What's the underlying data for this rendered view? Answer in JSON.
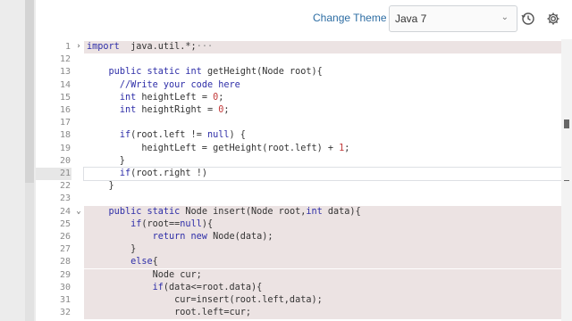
{
  "header": {
    "change_theme": "Change Theme",
    "language": "Java 7"
  },
  "editor": {
    "lines": [
      {
        "n": "1",
        "fold": "›",
        "hl": "pink",
        "tokens": [
          [
            "kw",
            "import"
          ],
          [
            "",
            "  java.util.*;"
          ],
          [
            "ellip",
            "···"
          ]
        ]
      },
      {
        "n": "12",
        "fold": "",
        "hl": "",
        "tokens": []
      },
      {
        "n": "13",
        "fold": "",
        "hl": "",
        "tokens": [
          [
            "",
            "    "
          ],
          [
            "kw",
            "public static int"
          ],
          [
            "",
            " getHeight(Node root){"
          ]
        ]
      },
      {
        "n": "14",
        "fold": "",
        "hl": "",
        "tokens": [
          [
            "",
            "      "
          ],
          [
            "cm",
            "//Write your code here"
          ]
        ]
      },
      {
        "n": "15",
        "fold": "",
        "hl": "",
        "tokens": [
          [
            "",
            "      "
          ],
          [
            "kw",
            "int"
          ],
          [
            "",
            " heightLeft = "
          ],
          [
            "num",
            "0"
          ],
          [
            "",
            ";"
          ]
        ]
      },
      {
        "n": "16",
        "fold": "",
        "hl": "",
        "tokens": [
          [
            "",
            "      "
          ],
          [
            "kw",
            "int"
          ],
          [
            "",
            " heightRight = "
          ],
          [
            "num",
            "0"
          ],
          [
            "",
            ";"
          ]
        ]
      },
      {
        "n": "17",
        "fold": "",
        "hl": "",
        "tokens": []
      },
      {
        "n": "18",
        "fold": "",
        "hl": "",
        "tokens": [
          [
            "",
            "      "
          ],
          [
            "kw",
            "if"
          ],
          [
            "",
            "(root.left != "
          ],
          [
            "kw",
            "null"
          ],
          [
            "",
            ") {"
          ]
        ]
      },
      {
        "n": "19",
        "fold": "",
        "hl": "",
        "tokens": [
          [
            "",
            "          heightLeft = getHeight(root.left) + "
          ],
          [
            "num",
            "1"
          ],
          [
            "",
            ";"
          ]
        ]
      },
      {
        "n": "20",
        "fold": "",
        "hl": "",
        "tokens": [
          [
            "",
            "      }"
          ]
        ]
      },
      {
        "n": "21",
        "fold": "",
        "hl": "active",
        "tokens": [
          [
            "",
            "      "
          ],
          [
            "kw",
            "if"
          ],
          [
            "",
            "(root.right !)"
          ]
        ]
      },
      {
        "n": "22",
        "fold": "",
        "hl": "",
        "tokens": [
          [
            "",
            "    }"
          ]
        ]
      },
      {
        "n": "23",
        "fold": "",
        "hl": "",
        "tokens": []
      },
      {
        "n": "24",
        "fold": "⌄",
        "hl": "pink",
        "tokens": [
          [
            "",
            "    "
          ],
          [
            "kw",
            "public static"
          ],
          [
            "",
            " Node insert(Node root,"
          ],
          [
            "kw",
            "int"
          ],
          [
            "",
            " data){"
          ]
        ]
      },
      {
        "n": "25",
        "fold": "",
        "hl": "pink",
        "tokens": [
          [
            "",
            "        "
          ],
          [
            "kw",
            "if"
          ],
          [
            "",
            "(root=="
          ],
          [
            "kw",
            "null"
          ],
          [
            "",
            "){"
          ]
        ]
      },
      {
        "n": "26",
        "fold": "",
        "hl": "pink",
        "tokens": [
          [
            "",
            "            "
          ],
          [
            "kw",
            "return new"
          ],
          [
            "",
            " Node(data);"
          ]
        ]
      },
      {
        "n": "27",
        "fold": "",
        "hl": "pink",
        "tokens": [
          [
            "",
            "        }"
          ]
        ]
      },
      {
        "n": "28",
        "fold": "",
        "hl": "pink",
        "tokens": [
          [
            "",
            "        "
          ],
          [
            "kw",
            "else"
          ],
          [
            "",
            "{"
          ]
        ]
      },
      {
        "n": "29",
        "fold": "",
        "hl": "pink",
        "tokens": [
          [
            "",
            "            Node cur;"
          ]
        ]
      },
      {
        "n": "30",
        "fold": "",
        "hl": "pink",
        "tokens": [
          [
            "",
            "            "
          ],
          [
            "kw",
            "if"
          ],
          [
            "",
            "(data<=root.data){"
          ]
        ]
      },
      {
        "n": "31",
        "fold": "",
        "hl": "pink",
        "tokens": [
          [
            "",
            "                cur=insert(root.left,data);"
          ]
        ]
      },
      {
        "n": "32",
        "fold": "",
        "hl": "pink",
        "tokens": [
          [
            "",
            "                root.left=cur;"
          ]
        ]
      }
    ]
  }
}
